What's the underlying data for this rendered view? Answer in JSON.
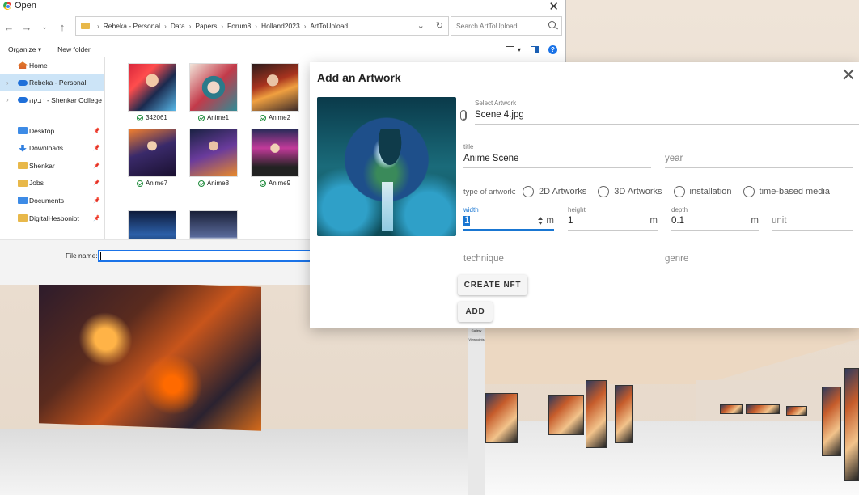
{
  "open_dialog": {
    "title": "Open",
    "breadcrumbs": [
      "Rebeka - Personal",
      "Data",
      "Papers",
      "Forum8",
      "Holland2023",
      "ArtToUpload"
    ],
    "search_placeholder": "Search ArtToUpload",
    "toolbar": {
      "organize": "Organize ▾",
      "new_folder": "New folder"
    },
    "sidebar": [
      {
        "label": "Home",
        "icon": "home-icon"
      },
      {
        "label": "Rebeka - Personal",
        "icon": "onedrive-icon"
      },
      {
        "label": "רבקה - Shenkar College",
        "icon": "onedrive-icon"
      },
      {
        "label": "Desktop",
        "icon": "desktop-icon"
      },
      {
        "label": "Downloads",
        "icon": "download-icon"
      },
      {
        "label": "Shenkar",
        "icon": "folder-icon"
      },
      {
        "label": "Jobs",
        "icon": "folder-icon"
      },
      {
        "label": "Documents",
        "icon": "documents-icon"
      },
      {
        "label": "DigitalHesboniot",
        "icon": "folder-icon"
      }
    ],
    "files": [
      {
        "name": "342061"
      },
      {
        "name": "Anime1"
      },
      {
        "name": "Anime2"
      },
      {
        "name": "Anime7"
      },
      {
        "name": "Anime8"
      },
      {
        "name": "Anime9"
      },
      {
        "name": ""
      },
      {
        "name": ""
      }
    ],
    "file_name_label": "File name:",
    "file_name_value": ""
  },
  "artwork_modal": {
    "title": "Add an Artwork",
    "select_artwork_label": "Select Artwork",
    "select_artwork_value": "Scene 4.jpg",
    "title_label": "title",
    "title_value": "Anime Scene",
    "year_placeholder": "year",
    "type_label": "type of artwork:",
    "type_options": [
      "2D Artworks",
      "3D Artworks",
      "installation",
      "time-based media"
    ],
    "width_label": "width",
    "width_value": "1",
    "height_label": "height",
    "height_value": "1",
    "depth_label": "depth",
    "depth_value": "0.1",
    "unit_suffix": "m",
    "unit_placeholder": "unit",
    "technique_placeholder": "technique",
    "genre_placeholder": "genre",
    "create_nft_label": "CREATE NFT",
    "add_label": "ADD"
  },
  "gallery": {
    "pillar_labels": [
      "Gallery",
      "Viewpoints"
    ]
  }
}
